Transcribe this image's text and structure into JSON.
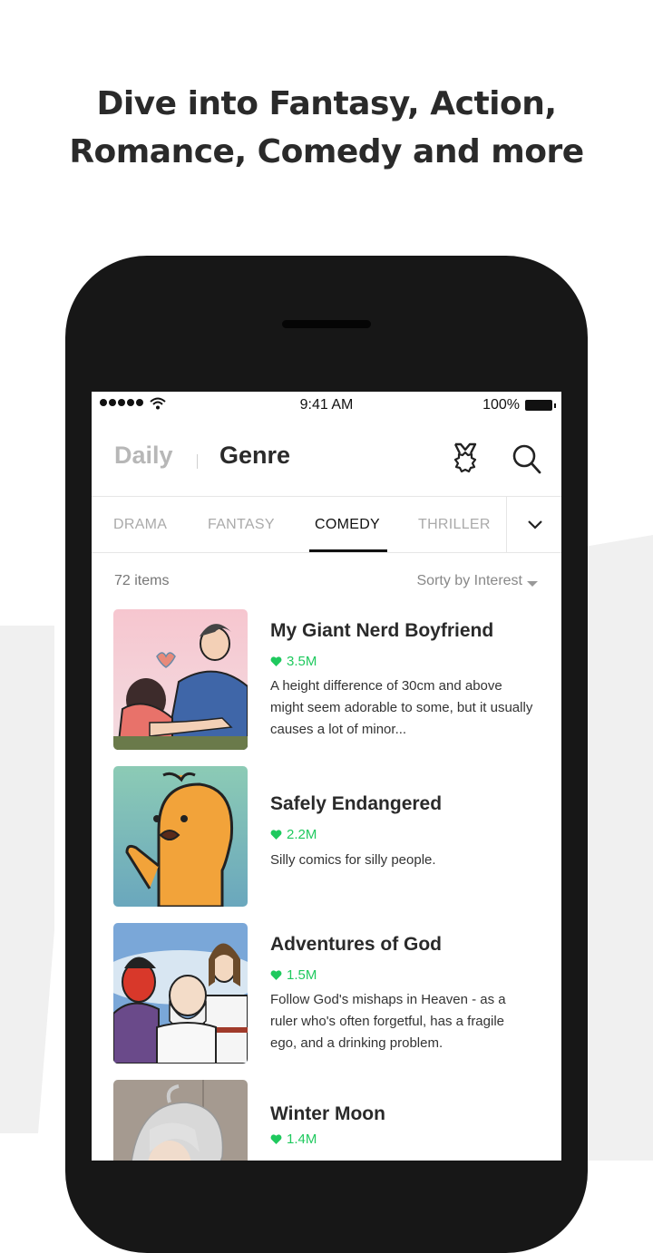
{
  "headline": {
    "line1": "Dive into Fantasy, Action,",
    "line2": "Romance, Comedy and more"
  },
  "statusbar": {
    "time": "9:41 AM",
    "battery": "100%",
    "signal_icon": "signal-dots-icon",
    "wifi_icon": "wifi-icon",
    "battery_icon": "battery-icon"
  },
  "appbar": {
    "tab_daily": "Daily",
    "tab_genre": "Genre",
    "medal_icon": "medal-icon",
    "search_icon": "search-icon"
  },
  "genre_tabs": [
    {
      "label": "DRAMA",
      "active": false
    },
    {
      "label": "FANTASY",
      "active": false
    },
    {
      "label": "COMEDY",
      "active": true
    },
    {
      "label": "THRILLER",
      "active": false
    }
  ],
  "more_icon": "chevron-down-icon",
  "list": {
    "count": "72 items",
    "sort": "Sorty by Interest"
  },
  "accent_color": "#1fc95e",
  "items": [
    {
      "title": "My Giant Nerd Boyfriend",
      "likes": "3.5M",
      "description": "A height difference of 30cm and above might seem adorable to some, but it usually causes a lot of minor..."
    },
    {
      "title": "Safely Endangered",
      "likes": "2.2M",
      "description": "Silly comics for silly people."
    },
    {
      "title": "Adventures of God",
      "likes": "1.5M",
      "description": "Follow God's mishaps in Heaven - as a ruler who's often forgetful, has a fragile ego, and a drinking problem."
    },
    {
      "title": "Winter Moon",
      "likes": "1.4M",
      "description": ""
    }
  ]
}
